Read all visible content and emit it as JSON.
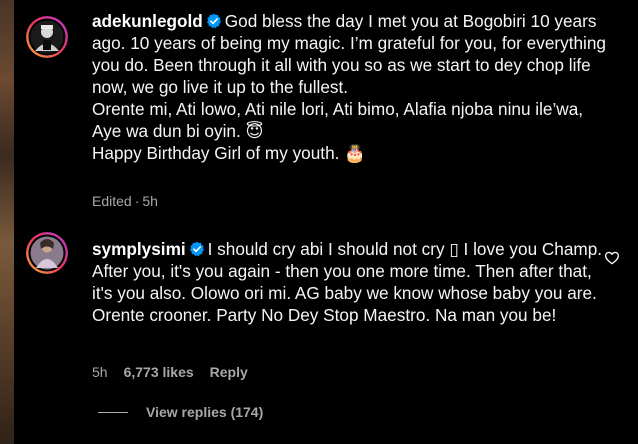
{
  "comments": [
    {
      "username": "adekunlegold",
      "text": "God bless the day I met you at Bogobiri 10 years ago. 10 years of being my magic. I’m grateful for you, for everything you do. Been through it all with you so as we start to dey chop life now, we go live it up to the fullest.",
      "text2": "Orente mi, Ati lowo, Ati nile lori, Ati bimo, Alafia njoba ninu ile’wa, Aye wa dun bi oyin. 😇",
      "text3": "Happy Birthday Girl of my youth. 🎂",
      "meta_edited": "Edited",
      "meta_time": "5h",
      "meta_separator": "·"
    },
    {
      "username": "symplysimi",
      "text": "I should cry abi I should not cry ▯ I love you Champ. After you, it's you again - then you one more time. Then after that, it's you also. Olowo ori mi. AG baby we know whose baby you are. Orente crooner. Party No Dey Stop Maestro. Na man you be!",
      "meta_time": "5h",
      "meta_likes": "6,773 likes",
      "meta_reply": "Reply",
      "view_replies": "View replies (174)"
    }
  ],
  "icons": {
    "verified": "verified-badge-icon",
    "heart": "heart-outline-icon"
  },
  "colors": {
    "background": "#000000",
    "text": "#f5f5f5",
    "secondary": "#a8a8a8",
    "verified": "#0095f6"
  }
}
